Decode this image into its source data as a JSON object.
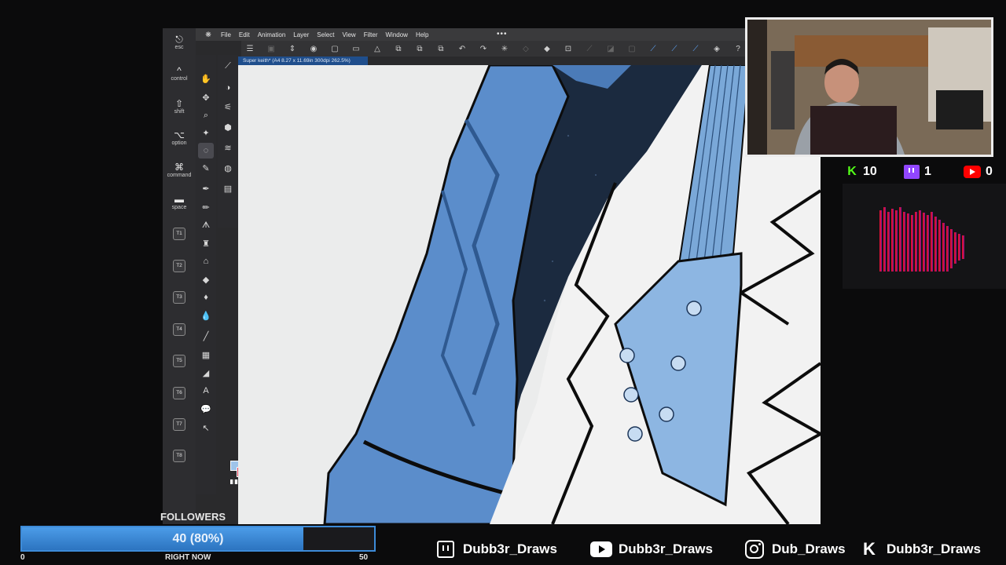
{
  "app": {
    "menu": [
      "File",
      "Edit",
      "Animation",
      "Layer",
      "Select",
      "View",
      "Filter",
      "Window",
      "Help"
    ],
    "document_tab": "Super keith* (A4 8.27 x 11.69in 300dpi 262.5%)",
    "modifiers": [
      {
        "glyph": "⎋",
        "label": "esc"
      },
      {
        "glyph": "^",
        "label": "control"
      },
      {
        "glyph": "⇧",
        "label": "shift"
      },
      {
        "glyph": "⌥",
        "label": "option"
      },
      {
        "glyph": "⌘",
        "label": "command"
      },
      {
        "glyph": "▬",
        "label": "space"
      }
    ],
    "t_keys": [
      "T1",
      "T2",
      "T3",
      "T4",
      "T5",
      "T6",
      "T7",
      "T8"
    ]
  },
  "overlay": {
    "kick_count": "10",
    "twitch_count": "1",
    "youtube_count": "0",
    "followers": {
      "title": "FOLLOWERS",
      "label": "40 (80%)",
      "progress": 0.8,
      "min": "0",
      "max": "50",
      "caption": "RIGHT NOW"
    },
    "socials": [
      {
        "platform": "twitch",
        "handle": "Dubb3r_Draws"
      },
      {
        "platform": "youtube",
        "handle": "Dubb3r_Draws"
      },
      {
        "platform": "instagram",
        "handle": "Dub_Draws"
      },
      {
        "platform": "kick",
        "handle": "Dubb3r_Draws"
      }
    ],
    "colors": {
      "kick": "#53fc18",
      "twitch": "#9146ff",
      "youtube": "#ff0000",
      "accent": "#3d8bd8"
    }
  }
}
